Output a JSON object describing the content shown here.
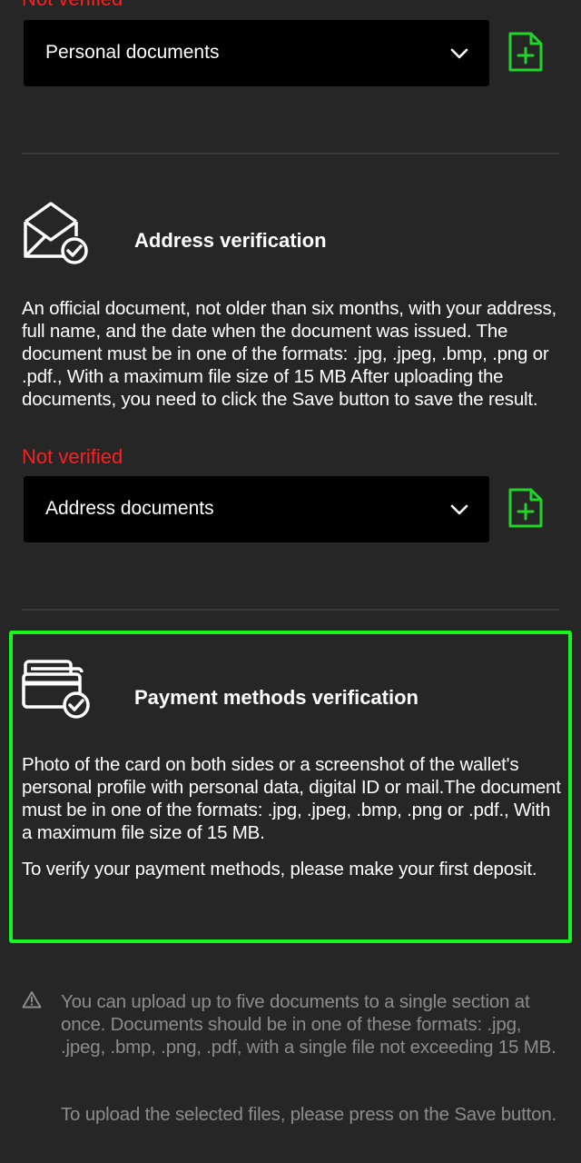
{
  "personal": {
    "status": "Not verified",
    "select_value": "Personal documents"
  },
  "address": {
    "title": "Address verification",
    "description": "An official document, not older than six months, with your address, full name, and the date when the document was issued. The document must be in one of the formats: .jpg, .jpeg, .bmp, .png or .pdf., With a maximum file size of 15 MB After uploading the documents, you need to click the Save button to save the result.",
    "status": "Not verified",
    "select_value": "Address documents"
  },
  "payment": {
    "title": "Payment methods verification",
    "description": "Photo of the card on both sides or a screenshot of the wallet's personal profile with personal data, digital ID or mail.The document must be in one of the formats: .jpg, .jpeg, .bmp, .png or .pdf., With a maximum file size of 15 MB.",
    "deposit_note": "To verify your payment methods, please make your first deposit."
  },
  "notice": {
    "text": "You can upload up to five documents to a single section at once. Documents should be in one of these formats: .jpg, .jpeg, .bmp, .png, .pdf, with a single file not exceeding 15 MB.",
    "save_hint": "To upload the selected files, please press on the Save button."
  },
  "colors": {
    "background": "#262626",
    "status_error": "#ff1f1f",
    "accent_green": "#16f51d",
    "select_bg": "#000000",
    "muted_text": "#8c8c8c"
  },
  "icons": {
    "chevron": "chevron-down-icon",
    "upload": "file-add-icon",
    "address": "envelope-check-icon",
    "payment": "cards-check-icon",
    "notice": "warning-icon"
  }
}
